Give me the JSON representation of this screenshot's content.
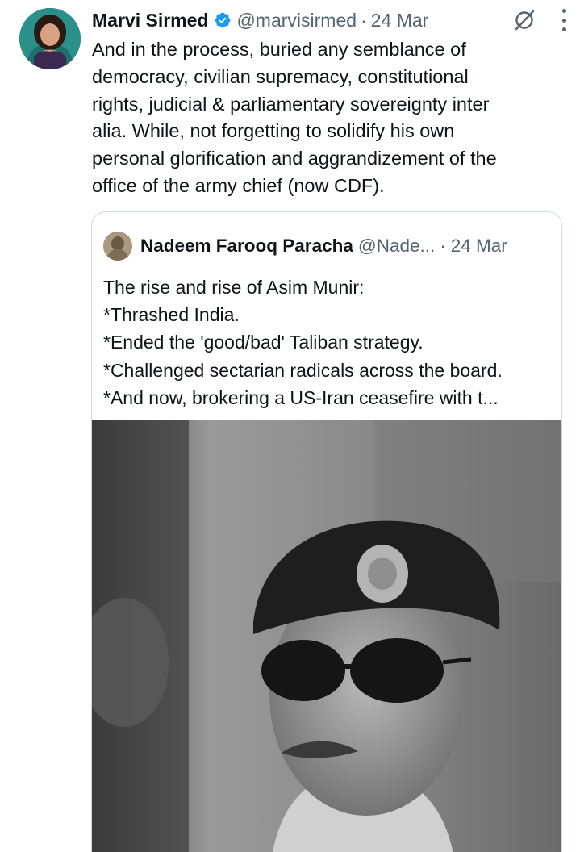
{
  "tweet": {
    "author_name": "Marvi Sirmed",
    "author_handle": "@marvisirmed",
    "separator": "·",
    "date": "24 Mar",
    "text": "And in the process, buried any semblance of democracy, civilian supremacy, constitutional rights, judicial & parliamentary sovereignty inter alia. While, not forgetting to solidify his own personal glorification and aggrandizement of the office of the army chief (now CDF).",
    "text_lines": [
      "And in the process, buried any semblance of",
      "democracy, civilian supremacy, constitutional",
      "rights, judicial & parliamentary sovereignty inter",
      "alia. While, not forgetting to solidify his own",
      "personal glorification and aggrandizement of the",
      "office of the army chief (now CDF)."
    ],
    "icons": {
      "verified": "verified-badge-icon",
      "grok": "grok-icon",
      "more": "more-options-icon"
    }
  },
  "quoted_tweet": {
    "author_name": "Nadeem Farooq Paracha",
    "author_handle": "@Nade...",
    "separator": "·",
    "date": "24 Mar",
    "lines": [
      "The rise and rise of Asim Munir:",
      "*Thrashed India.",
      "*Ended the 'good/bad' Taliban strategy.",
      "*Challenged sectarian radicals across the board.",
      "*And now, brokering a US-Iran ceasefire with t..."
    ]
  },
  "colors": {
    "text_primary": "#0f1419",
    "text_secondary": "#536471",
    "verified_blue": "#1d9bf0",
    "border": "#cfd9de"
  }
}
